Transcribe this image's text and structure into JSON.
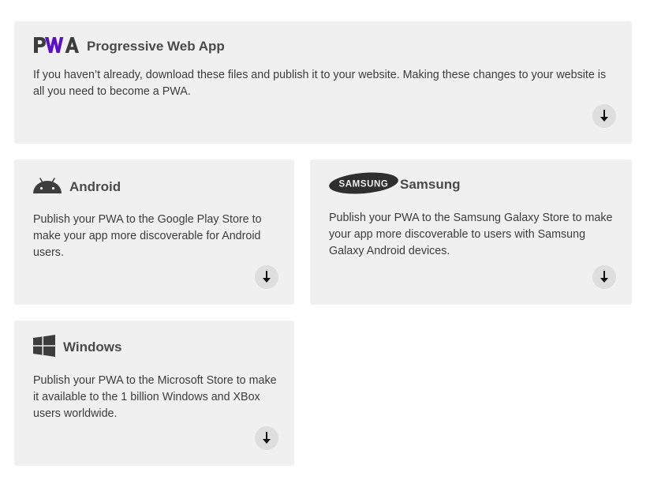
{
  "cards": {
    "pwa": {
      "title": "Progressive Web App",
      "description": "If you haven’t already, download these files and publish it to your website. Making these changes to your website is all you need to become a PWA.",
      "logo_text": "PWA",
      "icon": "pwa-logo-icon",
      "button_icon": "download-arrow-icon"
    },
    "android": {
      "title": "Android",
      "description": "Publish your PWA to the Google Play Store to make your app more discoverable for Android users.",
      "icon": "android-icon",
      "button_icon": "download-arrow-icon"
    },
    "samsung": {
      "title": "Samsung",
      "description": "Publish your PWA to the Samsung Galaxy Store to make your app more discoverable to users with Samsung Galaxy Android devices.",
      "logo_text": "SAMSUNG",
      "icon": "samsung-logo-icon",
      "button_icon": "download-arrow-icon"
    },
    "windows": {
      "title": "Windows",
      "description": "Publish your PWA to the Microsoft Store to make it available to the 1 billion Windows and XBox users worldwide.",
      "icon": "windows-icon",
      "button_icon": "download-arrow-icon"
    }
  },
  "colors": {
    "card_background": "#f0f0f0",
    "button_background": "#dedede",
    "pwa_accent": "#5a0fc8",
    "icon_dark": "#3d3d3d"
  }
}
